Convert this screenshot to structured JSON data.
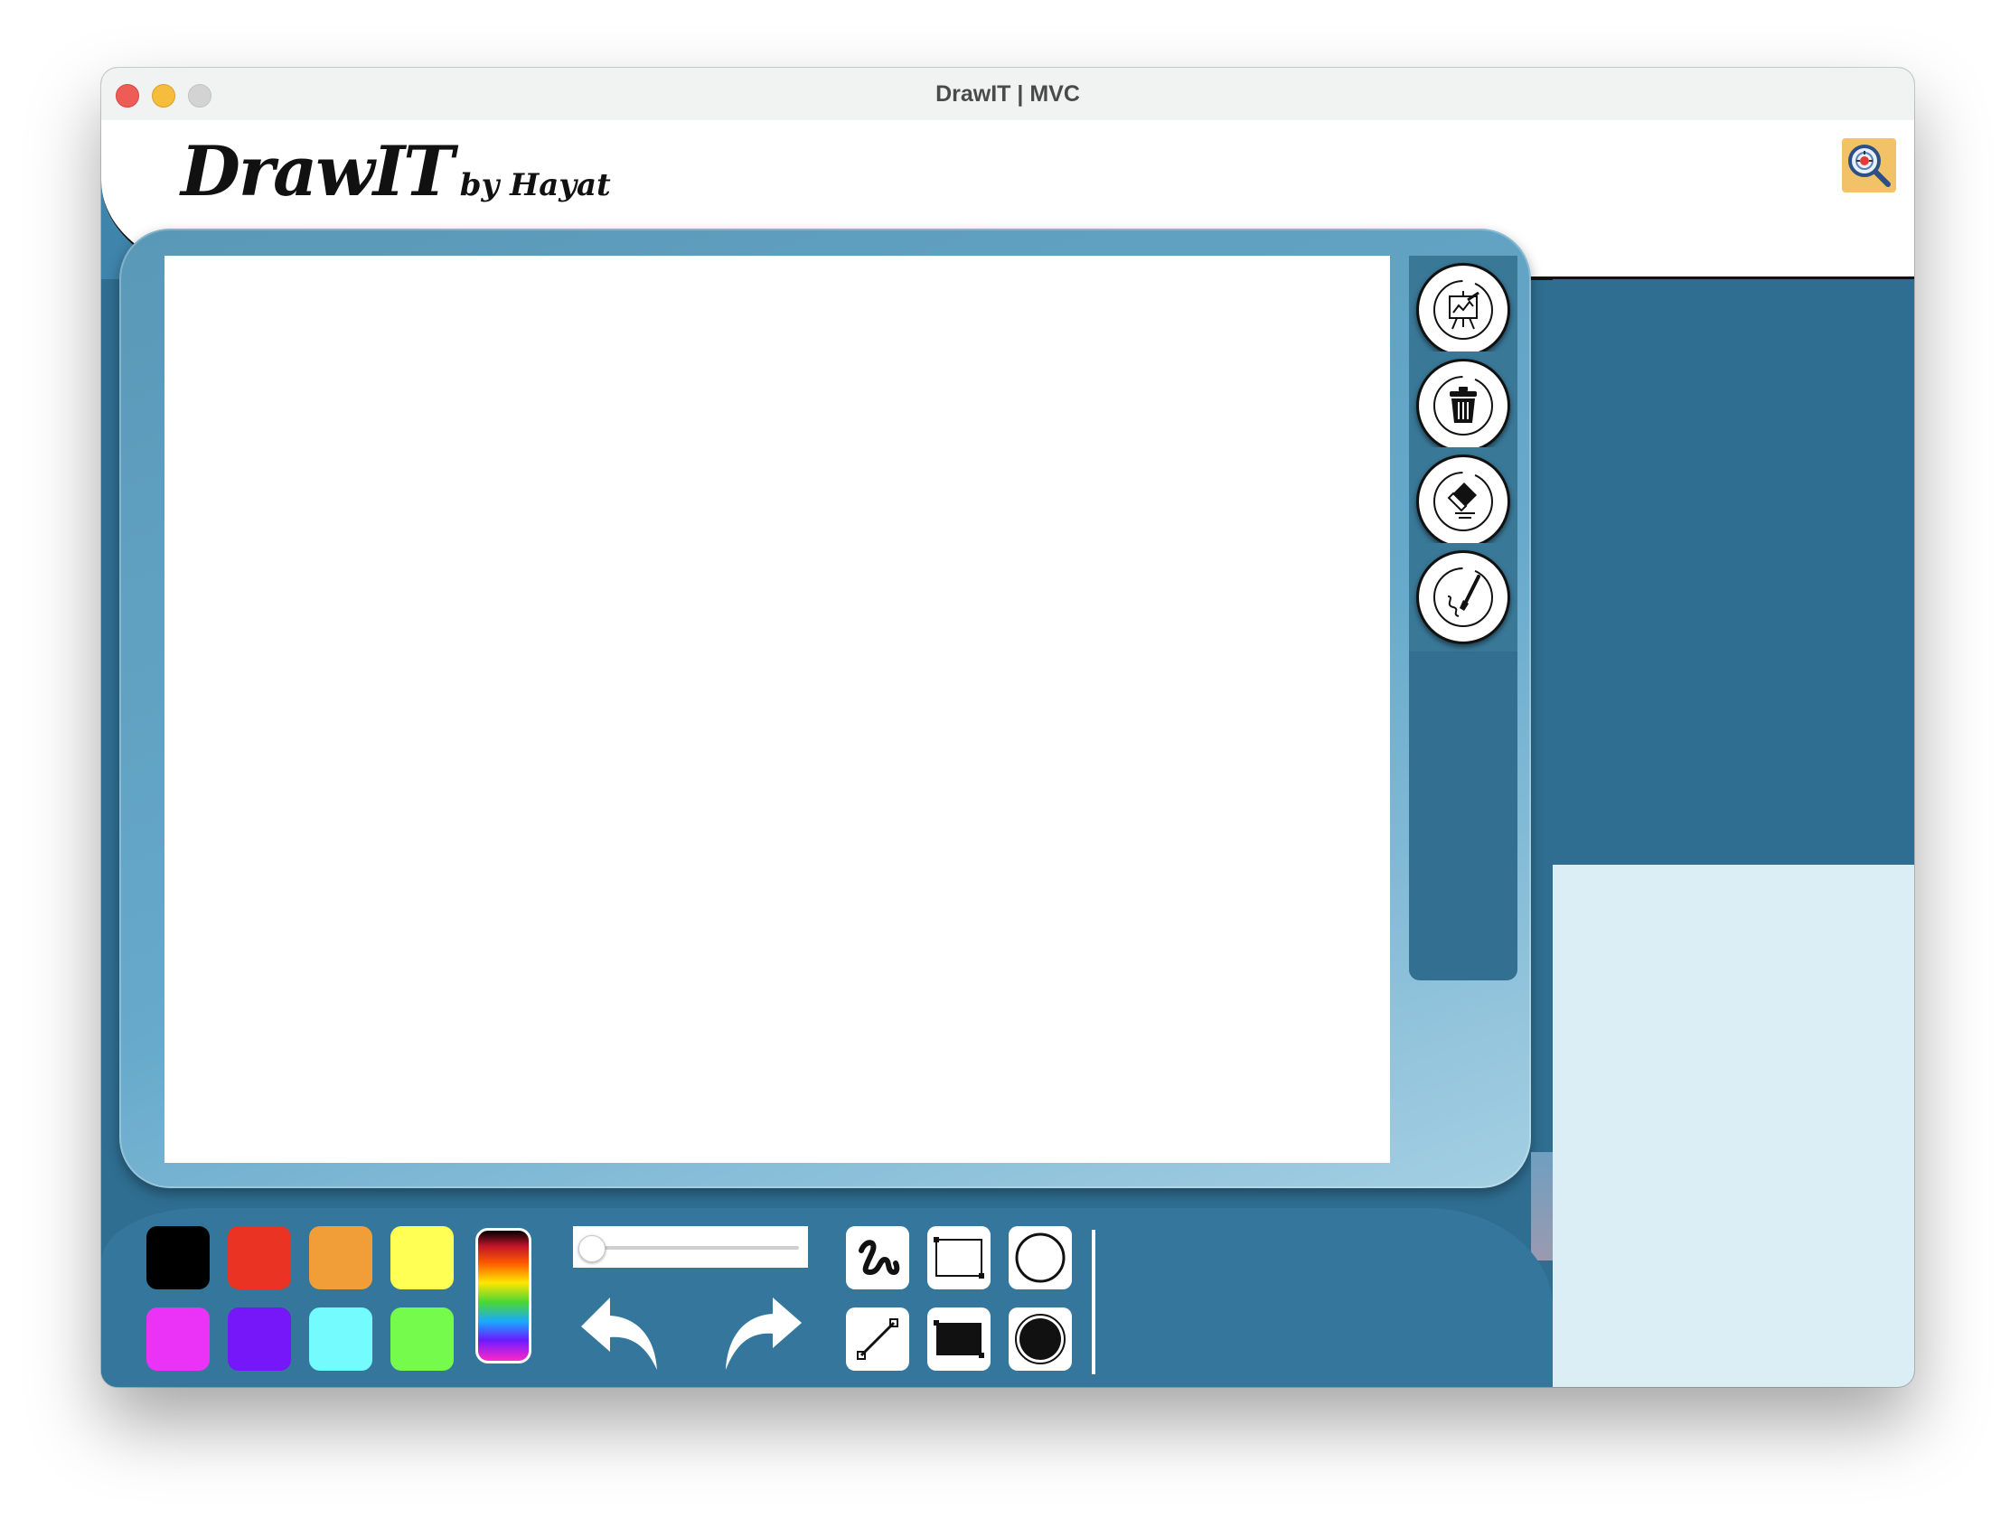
{
  "window": {
    "title": "DrawIT | MVC"
  },
  "header": {
    "logo_main": "DrawIT",
    "logo_sub": "by Hayat",
    "search_icon": "magnifier-bug-icon"
  },
  "side_tools": [
    {
      "name": "presentation-easel-icon",
      "label": "easel"
    },
    {
      "name": "trash-icon",
      "label": "trash"
    },
    {
      "name": "eraser-icon",
      "label": "eraser"
    },
    {
      "name": "brush-icon",
      "label": "brush"
    }
  ],
  "palette": {
    "colors": [
      {
        "name": "black",
        "hex": "#000000"
      },
      {
        "name": "red",
        "hex": "#ea3323"
      },
      {
        "name": "orange",
        "hex": "#f19e38"
      },
      {
        "name": "yellow",
        "hex": "#ffff54"
      },
      {
        "name": "magenta",
        "hex": "#ea33f7"
      },
      {
        "name": "purple",
        "hex": "#7517f8"
      },
      {
        "name": "cyan",
        "hex": "#73fbfd"
      },
      {
        "name": "green",
        "hex": "#75fb4c"
      }
    ],
    "custom_color_icon": "rainbow-gradient-icon"
  },
  "stroke_size": {
    "value": 0.0
  },
  "history": {
    "undo_icon": "undo-arrow-icon",
    "redo_icon": "redo-arrow-icon"
  },
  "shapes": [
    {
      "name": "freehand-icon"
    },
    {
      "name": "rectangle-outline-icon"
    },
    {
      "name": "circle-outline-icon"
    },
    {
      "name": "line-icon"
    },
    {
      "name": "rectangle-filled-icon"
    },
    {
      "name": "circle-filled-icon"
    }
  ]
}
